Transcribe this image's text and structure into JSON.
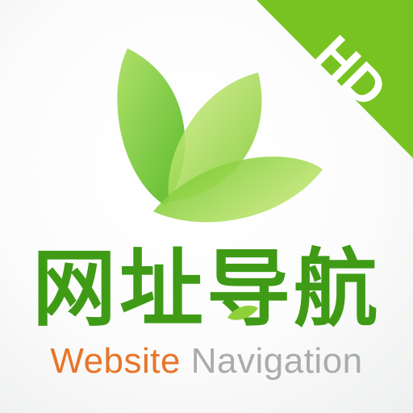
{
  "banner": {
    "label": "HD",
    "color": "#78c321"
  },
  "title": {
    "text": "网址导航",
    "color": "#3f9b16"
  },
  "subtitle": {
    "word1": "Website",
    "word2": "Navigation",
    "word1_color": "#e8752a",
    "word2_color": "#a9acab"
  },
  "logo": {
    "icon": "green-leaves-icon",
    "colors": [
      "#5cc21f",
      "#8fd13a",
      "#b8e06a"
    ]
  }
}
